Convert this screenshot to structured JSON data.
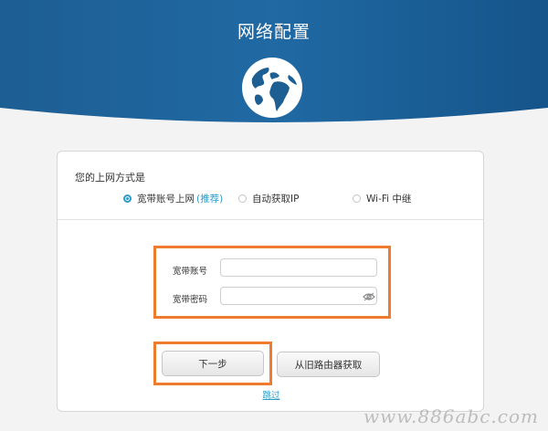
{
  "header": {
    "title": "网络配置",
    "icon": "globe-icon"
  },
  "connection": {
    "question": "您的上网方式是",
    "options": [
      {
        "label": "宽带账号上网",
        "badge": "(推荐)",
        "selected": true
      },
      {
        "label": "自动获取IP",
        "selected": false
      },
      {
        "label": "Wi-Fi 中继",
        "selected": false
      }
    ]
  },
  "form": {
    "account_label": "宽带账号",
    "account_value": "",
    "password_label": "宽带密码",
    "password_value": "",
    "password_icon": "eye-icon"
  },
  "actions": {
    "next_label": "下一步",
    "fetch_label": "从旧路由器获取",
    "skip_label": "跳过"
  },
  "watermark": "www.886abc.com",
  "colors": {
    "header_blue": "#1a5f94",
    "accent_blue": "#2b9bc7",
    "highlight_orange": "#ee7b2e"
  }
}
